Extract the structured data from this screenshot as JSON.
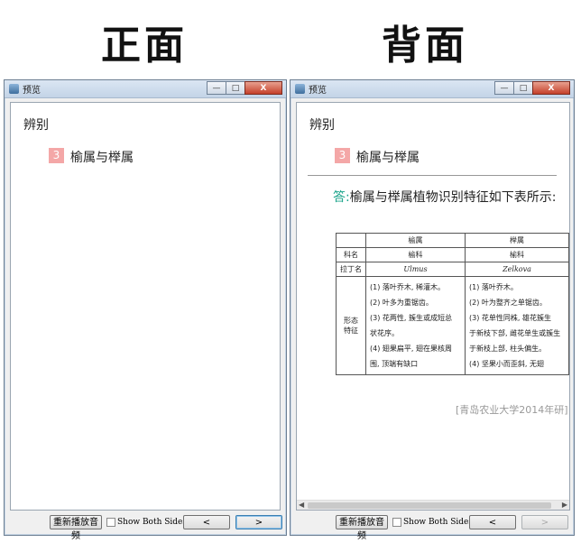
{
  "headings": {
    "front": "正面",
    "back": "背面"
  },
  "front_window": {
    "title": "预览",
    "controls": {
      "minimize": "—",
      "maximize": "□",
      "close": "X"
    },
    "section": "辨别",
    "question": {
      "number": "3",
      "title": "榆属与榉属"
    },
    "bottom": {
      "replay": "重新播放音频",
      "show_both": "Show Both Sides",
      "prev": "<",
      "next": ">"
    }
  },
  "back_window": {
    "title": "预览",
    "controls": {
      "minimize": "—",
      "maximize": "□",
      "close": "X"
    },
    "section": "辨别",
    "question": {
      "number": "3",
      "title": "榆属与榉属"
    },
    "answer": {
      "lead": "答:",
      "text": "榆属与榉属植物识别特征如下表所示:"
    },
    "table": {
      "headers": [
        "",
        "榆属",
        "榉属"
      ],
      "rows": [
        {
          "label": "科名",
          "a": "榆科",
          "b": "榆科"
        },
        {
          "label": "拉丁名",
          "a": "Ulmus",
          "b": "Zelkova"
        }
      ],
      "feature": {
        "label_1": "形态",
        "label_2": "特征",
        "a_lines": [
          "(1) 落叶乔木, 稀灌木。",
          "(2) 叶多为重锯齿。",
          "(3) 花两性, 簇生或成短总",
          "状花序。",
          "(4) 翅果扁平, 翅在果核周",
          "围, 顶端有缺口"
        ],
        "b_lines": [
          "(1) 落叶乔木。",
          "(2) 叶为整齐之单锯齿。",
          "(3) 花单性同株, 雄花簇生",
          "于新枝下部, 雌花单生或簇生",
          "于新枝上部, 柱头偏生。",
          "(4) 坚果小而歪斜, 无翅"
        ]
      }
    },
    "source": "[青岛农业大学2014年研]",
    "bottom": {
      "replay": "重新播放音频",
      "show_both": "Show Both Sides",
      "prev": "<",
      "next": ">"
    }
  }
}
